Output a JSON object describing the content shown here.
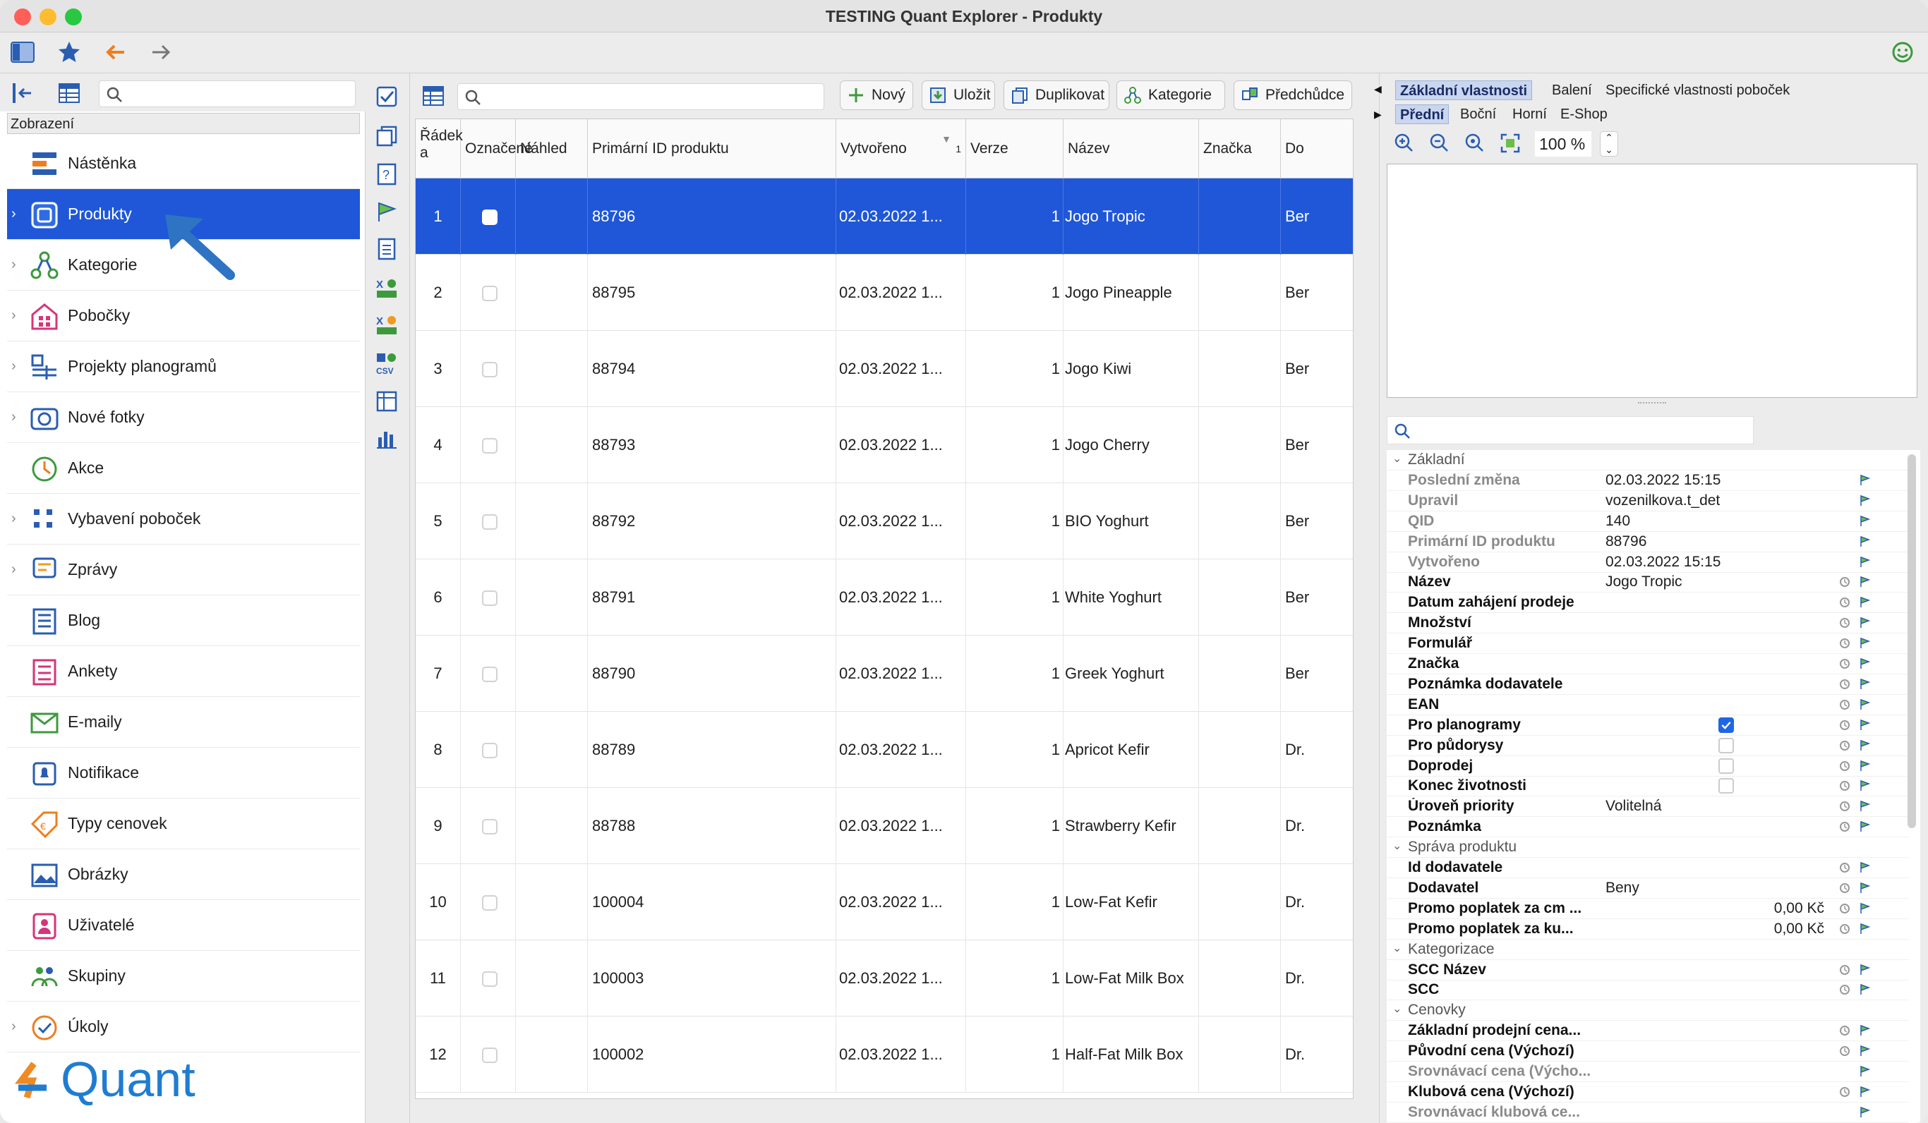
{
  "window": {
    "title": "TESTING Quant Explorer - Produkty"
  },
  "sidebar": {
    "header": "Zobrazení",
    "items": [
      {
        "label": "Nástěnka",
        "icon": "dashboard-icon",
        "chevron": false,
        "active": false
      },
      {
        "label": "Produkty",
        "icon": "products-icon",
        "chevron": true,
        "active": true
      },
      {
        "label": "Kategorie",
        "icon": "categories-icon",
        "chevron": true,
        "active": false
      },
      {
        "label": "Pobočky",
        "icon": "branches-icon",
        "chevron": true,
        "active": false
      },
      {
        "label": "Projekty planogramů",
        "icon": "planogram-projects-icon",
        "chevron": true,
        "active": false
      },
      {
        "label": "Nové fotky",
        "icon": "camera-icon",
        "chevron": true,
        "active": false
      },
      {
        "label": "Akce",
        "icon": "clock-icon",
        "chevron": false,
        "active": false
      },
      {
        "label": "Vybavení poboček",
        "icon": "equipment-icon",
        "chevron": true,
        "active": false
      },
      {
        "label": "Zprávy",
        "icon": "messages-icon",
        "chevron": true,
        "active": false
      },
      {
        "label": "Blog",
        "icon": "blog-icon",
        "chevron": false,
        "active": false
      },
      {
        "label": "Ankety",
        "icon": "survey-icon",
        "chevron": false,
        "active": false
      },
      {
        "label": "E-maily",
        "icon": "mail-icon",
        "chevron": false,
        "active": false
      },
      {
        "label": "Notifikace",
        "icon": "bell-icon",
        "chevron": false,
        "active": false
      },
      {
        "label": "Typy cenovek",
        "icon": "price-tag-icon",
        "chevron": false,
        "active": false
      },
      {
        "label": "Obrázky",
        "icon": "image-icon",
        "chevron": false,
        "active": false
      },
      {
        "label": "Uživatelé",
        "icon": "user-icon",
        "chevron": false,
        "active": false
      },
      {
        "label": "Skupiny",
        "icon": "groups-icon",
        "chevron": false,
        "active": false
      },
      {
        "label": "Úkoly",
        "icon": "tasks-icon",
        "chevron": true,
        "active": false
      }
    ],
    "logo_text": "Quant"
  },
  "toolbar": {
    "new_label": "Nový",
    "save_label": "Uložit",
    "duplicate_label": "Duplikovat",
    "category_label": "Kategorie",
    "ancestor_label": "Předchůdce"
  },
  "grid": {
    "columns": [
      "Řádek a",
      "Označené",
      "Náhled",
      "Primární ID produktu",
      "Vytvořeno",
      "Verze",
      "Název",
      "Značka",
      "Do"
    ],
    "sort_indicator": "1",
    "rows": [
      {
        "row": "1",
        "id": "88796",
        "created": "02.03.2022 1...",
        "version": "1",
        "name": "Jogo Tropic",
        "do": "Ber"
      },
      {
        "row": "2",
        "id": "88795",
        "created": "02.03.2022 1...",
        "version": "1",
        "name": "Jogo Pineapple",
        "do": "Ber"
      },
      {
        "row": "3",
        "id": "88794",
        "created": "02.03.2022 1...",
        "version": "1",
        "name": "Jogo Kiwi",
        "do": "Ber"
      },
      {
        "row": "4",
        "id": "88793",
        "created": "02.03.2022 1...",
        "version": "1",
        "name": "Jogo Cherry",
        "do": "Ber"
      },
      {
        "row": "5",
        "id": "88792",
        "created": "02.03.2022 1...",
        "version": "1",
        "name": "BIO Yoghurt",
        "do": "Ber"
      },
      {
        "row": "6",
        "id": "88791",
        "created": "02.03.2022 1...",
        "version": "1",
        "name": "White Yoghurt",
        "do": "Ber"
      },
      {
        "row": "7",
        "id": "88790",
        "created": "02.03.2022 1...",
        "version": "1",
        "name": "Greek Yoghurt",
        "do": "Ber"
      },
      {
        "row": "8",
        "id": "88789",
        "created": "02.03.2022 1...",
        "version": "1",
        "name": "Apricot Kefir",
        "do": "Dr."
      },
      {
        "row": "9",
        "id": "88788",
        "created": "02.03.2022 1...",
        "version": "1",
        "name": "Strawberry Kefir",
        "do": "Dr."
      },
      {
        "row": "10",
        "id": "100004",
        "created": "02.03.2022 1...",
        "version": "1",
        "name": "Low-Fat Kefir",
        "do": "Dr."
      },
      {
        "row": "11",
        "id": "100003",
        "created": "02.03.2022 1...",
        "version": "1",
        "name": "Low-Fat Milk Box",
        "do": "Dr."
      },
      {
        "row": "12",
        "id": "100002",
        "created": "02.03.2022 1...",
        "version": "1",
        "name": "Half-Fat Milk Box",
        "do": "Dr."
      }
    ],
    "tooltip": "1"
  },
  "right_panel": {
    "tabs_top": [
      "Základní vlastnosti",
      "Balení",
      "Specifické vlastnosti poboček"
    ],
    "tabs_view": [
      "Přední",
      "Boční",
      "Horní",
      "E-Shop"
    ],
    "zoom": "100 %",
    "properties": [
      {
        "type": "section",
        "label": "Základní"
      },
      {
        "label": "Poslední změna",
        "value": "02.03.2022 15:15",
        "style": "grey"
      },
      {
        "label": "Upravil",
        "value": "vozenilkova.t_det",
        "style": "grey"
      },
      {
        "label": "QID",
        "value": "140",
        "style": "grey"
      },
      {
        "label": "Primární ID produktu",
        "value": "88796",
        "style": "grey"
      },
      {
        "label": "Vytvořeno",
        "value": "02.03.2022 15:15",
        "style": "grey"
      },
      {
        "label": "Název",
        "value": "Jogo Tropic",
        "style": "bold"
      },
      {
        "label": "Datum zahájení prodeje",
        "value": "",
        "style": "bold"
      },
      {
        "label": "Množství",
        "value": "",
        "style": "bold"
      },
      {
        "label": "Formulář",
        "value": "",
        "style": "bold"
      },
      {
        "label": "Značka",
        "value": "",
        "style": "bold"
      },
      {
        "label": "Poznámka dodavatele",
        "value": "",
        "style": "bold"
      },
      {
        "label": "EAN",
        "value": "",
        "style": "bold"
      },
      {
        "label": "Pro planogramy",
        "value": "",
        "style": "bold",
        "checkbox": "on"
      },
      {
        "label": "Pro půdorysy",
        "value": "",
        "style": "bold",
        "checkbox": "off"
      },
      {
        "label": "Doprodej",
        "value": "",
        "style": "bold",
        "checkbox": "off"
      },
      {
        "label": "Konec životnosti",
        "value": "",
        "style": "bold",
        "checkbox": "off"
      },
      {
        "label": "Úroveň priority",
        "value": "Volitelná",
        "style": "bold"
      },
      {
        "label": "Poznámka",
        "value": "",
        "style": "bold"
      },
      {
        "type": "section",
        "label": "Správa produktu"
      },
      {
        "label": "Id dodavatele",
        "value": "",
        "style": "bold"
      },
      {
        "label": "Dodavatel",
        "value": "Beny",
        "style": "bold"
      },
      {
        "label": "Promo poplatek za cm ...",
        "value": "0,00 Kč",
        "style": "bold",
        "align": "right"
      },
      {
        "label": "Promo poplatek za ku...",
        "value": "0,00 Kč",
        "style": "bold",
        "align": "right"
      },
      {
        "type": "section",
        "label": "Kategorizace"
      },
      {
        "label": "SCC Název",
        "value": "",
        "style": "bold"
      },
      {
        "label": "SCC",
        "value": "",
        "style": "bold"
      },
      {
        "type": "section",
        "label": "Cenovky"
      },
      {
        "label": "Základní prodejní cena...",
        "value": "",
        "style": "bold"
      },
      {
        "label": "Původní cena (Výchozí)",
        "value": "",
        "style": "bold"
      },
      {
        "label": "Srovnávací cena (Výcho...",
        "value": "",
        "style": "grey"
      },
      {
        "label": "Klubová cena (Výchozí)",
        "value": "",
        "style": "bold"
      },
      {
        "label": "Srovnávací klubová ce...",
        "value": "",
        "style": "grey"
      }
    ]
  },
  "colors": {
    "accent": "#1f57d8",
    "logo": "#1f7dd1"
  }
}
